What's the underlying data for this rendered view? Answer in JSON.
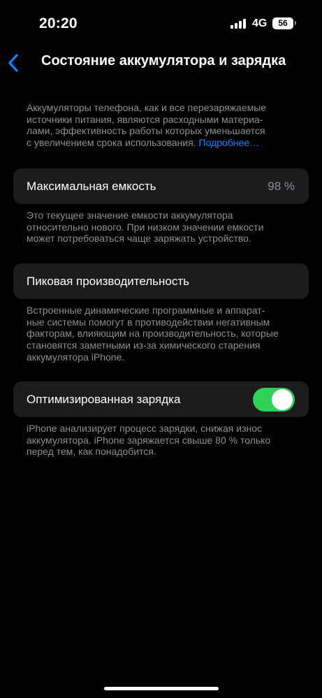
{
  "status_bar": {
    "time": "20:20",
    "network": "4G",
    "battery_level": "56"
  },
  "nav": {
    "title": "Состояние аккумулятора и зарядка",
    "back_icon": "chevron-left-icon"
  },
  "intro": {
    "lines": [
      "Аккумуляторы телефона, как и все перезаряжаемые",
      "источники питания, являются расходными материа-",
      "лами, эффективность работы которых уменьшается",
      "с увеличением срока использования."
    ],
    "link": "Подробнее…"
  },
  "max_capacity": {
    "label": "Максимальная емкость",
    "value": "98 %",
    "footnote": [
      "Это текущее значение емкости аккумулятора",
      "относительно нового. При низком значении емкости",
      "может потребоваться чаще заряжать устройство."
    ]
  },
  "peak_performance": {
    "label": "Пиковая производительность",
    "footnote": [
      "Встроенные динамические программные и аппарат-",
      "ные системы помогут в противодействии негативным",
      "факторам, влияющим на производительность, которые",
      "становятся заметными из-за химического старения",
      "аккумулятора iPhone."
    ]
  },
  "optimized_charging": {
    "label": "Оптимизированная зарядка",
    "enabled": true,
    "footnote": [
      "iPhone анализирует процесс зарядки, снижая износ",
      "аккумулятора. iPhone заряжается свыше 80 % только",
      "перед тем, как понадобится."
    ]
  },
  "colors": {
    "accent": "#0a84ff",
    "toggle_on": "#30d158",
    "cell_bg": "#1c1c1e",
    "secondary_text": "#8e8e93"
  }
}
